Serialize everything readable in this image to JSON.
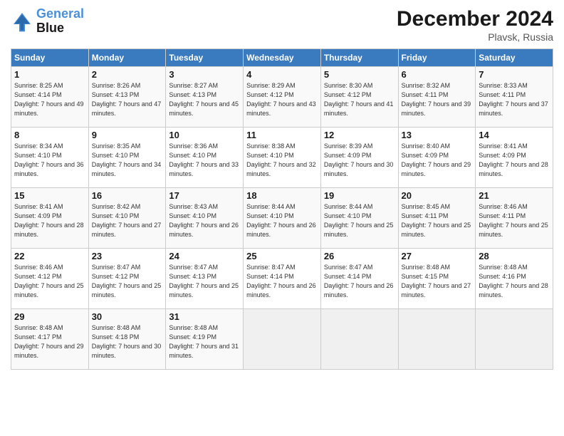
{
  "header": {
    "logo_line1": "General",
    "logo_line2": "Blue",
    "month_year": "December 2024",
    "location": "Plavsk, Russia"
  },
  "weekdays": [
    "Sunday",
    "Monday",
    "Tuesday",
    "Wednesday",
    "Thursday",
    "Friday",
    "Saturday"
  ],
  "weeks": [
    [
      {
        "day": "1",
        "sunrise": "8:25 AM",
        "sunset": "4:14 PM",
        "daylight": "7 hours and 49 minutes."
      },
      {
        "day": "2",
        "sunrise": "8:26 AM",
        "sunset": "4:13 PM",
        "daylight": "7 hours and 47 minutes."
      },
      {
        "day": "3",
        "sunrise": "8:27 AM",
        "sunset": "4:13 PM",
        "daylight": "7 hours and 45 minutes."
      },
      {
        "day": "4",
        "sunrise": "8:29 AM",
        "sunset": "4:12 PM",
        "daylight": "7 hours and 43 minutes."
      },
      {
        "day": "5",
        "sunrise": "8:30 AM",
        "sunset": "4:12 PM",
        "daylight": "7 hours and 41 minutes."
      },
      {
        "day": "6",
        "sunrise": "8:32 AM",
        "sunset": "4:11 PM",
        "daylight": "7 hours and 39 minutes."
      },
      {
        "day": "7",
        "sunrise": "8:33 AM",
        "sunset": "4:11 PM",
        "daylight": "7 hours and 37 minutes."
      }
    ],
    [
      {
        "day": "8",
        "sunrise": "8:34 AM",
        "sunset": "4:10 PM",
        "daylight": "7 hours and 36 minutes."
      },
      {
        "day": "9",
        "sunrise": "8:35 AM",
        "sunset": "4:10 PM",
        "daylight": "7 hours and 34 minutes."
      },
      {
        "day": "10",
        "sunrise": "8:36 AM",
        "sunset": "4:10 PM",
        "daylight": "7 hours and 33 minutes."
      },
      {
        "day": "11",
        "sunrise": "8:38 AM",
        "sunset": "4:10 PM",
        "daylight": "7 hours and 32 minutes."
      },
      {
        "day": "12",
        "sunrise": "8:39 AM",
        "sunset": "4:09 PM",
        "daylight": "7 hours and 30 minutes."
      },
      {
        "day": "13",
        "sunrise": "8:40 AM",
        "sunset": "4:09 PM",
        "daylight": "7 hours and 29 minutes."
      },
      {
        "day": "14",
        "sunrise": "8:41 AM",
        "sunset": "4:09 PM",
        "daylight": "7 hours and 28 minutes."
      }
    ],
    [
      {
        "day": "15",
        "sunrise": "8:41 AM",
        "sunset": "4:09 PM",
        "daylight": "7 hours and 28 minutes."
      },
      {
        "day": "16",
        "sunrise": "8:42 AM",
        "sunset": "4:10 PM",
        "daylight": "7 hours and 27 minutes."
      },
      {
        "day": "17",
        "sunrise": "8:43 AM",
        "sunset": "4:10 PM",
        "daylight": "7 hours and 26 minutes."
      },
      {
        "day": "18",
        "sunrise": "8:44 AM",
        "sunset": "4:10 PM",
        "daylight": "7 hours and 26 minutes."
      },
      {
        "day": "19",
        "sunrise": "8:44 AM",
        "sunset": "4:10 PM",
        "daylight": "7 hours and 25 minutes."
      },
      {
        "day": "20",
        "sunrise": "8:45 AM",
        "sunset": "4:11 PM",
        "daylight": "7 hours and 25 minutes."
      },
      {
        "day": "21",
        "sunrise": "8:46 AM",
        "sunset": "4:11 PM",
        "daylight": "7 hours and 25 minutes."
      }
    ],
    [
      {
        "day": "22",
        "sunrise": "8:46 AM",
        "sunset": "4:12 PM",
        "daylight": "7 hours and 25 minutes."
      },
      {
        "day": "23",
        "sunrise": "8:47 AM",
        "sunset": "4:12 PM",
        "daylight": "7 hours and 25 minutes."
      },
      {
        "day": "24",
        "sunrise": "8:47 AM",
        "sunset": "4:13 PM",
        "daylight": "7 hours and 25 minutes."
      },
      {
        "day": "25",
        "sunrise": "8:47 AM",
        "sunset": "4:14 PM",
        "daylight": "7 hours and 26 minutes."
      },
      {
        "day": "26",
        "sunrise": "8:47 AM",
        "sunset": "4:14 PM",
        "daylight": "7 hours and 26 minutes."
      },
      {
        "day": "27",
        "sunrise": "8:48 AM",
        "sunset": "4:15 PM",
        "daylight": "7 hours and 27 minutes."
      },
      {
        "day": "28",
        "sunrise": "8:48 AM",
        "sunset": "4:16 PM",
        "daylight": "7 hours and 28 minutes."
      }
    ],
    [
      {
        "day": "29",
        "sunrise": "8:48 AM",
        "sunset": "4:17 PM",
        "daylight": "7 hours and 29 minutes."
      },
      {
        "day": "30",
        "sunrise": "8:48 AM",
        "sunset": "4:18 PM",
        "daylight": "7 hours and 30 minutes."
      },
      {
        "day": "31",
        "sunrise": "8:48 AM",
        "sunset": "4:19 PM",
        "daylight": "7 hours and 31 minutes."
      },
      null,
      null,
      null,
      null
    ]
  ]
}
